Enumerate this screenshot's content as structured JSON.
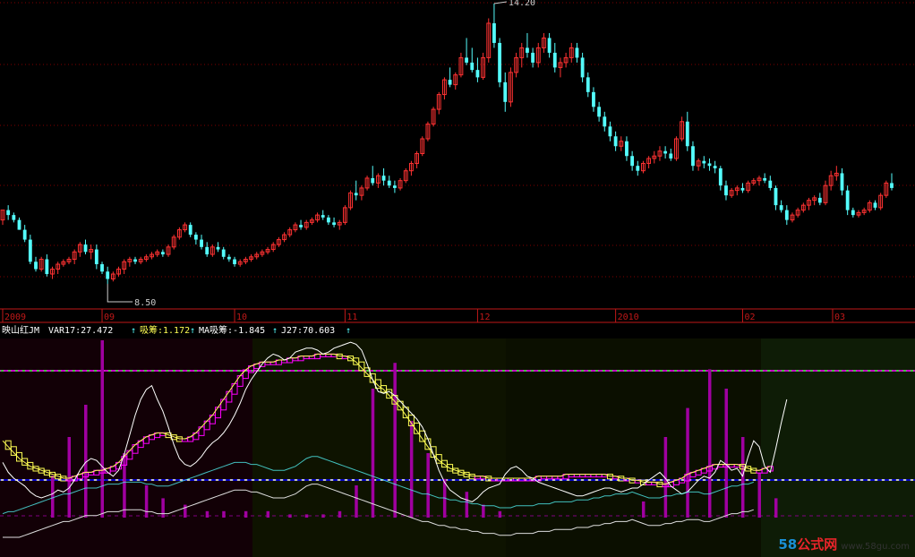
{
  "colors": {
    "up": "#ff3232",
    "down": "#54fcfc",
    "grid": "#800000",
    "axis": "#c01818",
    "var17": "#ffffff",
    "xichou": "#ff00ff",
    "ma_xichou": "#ffff54",
    "j27": "#54fcfc",
    "bars": "#a000a0",
    "line_top": "#54ff54",
    "line_mid_white": "#ffffff",
    "line_mid_blue": "#0000ff",
    "line_low": "#800080"
  },
  "chart_data": {
    "type": "candlestick",
    "price_labels": {
      "high": "14.20",
      "low": "8.50"
    },
    "x_ticks": [
      "2009",
      "09",
      "10",
      "11",
      "12",
      "2010",
      "02",
      "03"
    ],
    "indicator": {
      "name": "映山红JM",
      "items": [
        {
          "label": "VAR17",
          "value": "27.472",
          "color": "#ffffff"
        },
        {
          "label": "吸筹",
          "value": "1.172",
          "color": "#ffff54"
        },
        {
          "label": "MA吸筹",
          "value": "-1.845",
          "color": "#ffffff"
        },
        {
          "label": "J27",
          "value": "70.603",
          "color": "#ffffff"
        }
      ]
    },
    "candles": [
      [
        9.8,
        10.0,
        9.7,
        10.0
      ],
      [
        10.0,
        10.1,
        9.8,
        9.9
      ],
      [
        9.9,
        9.95,
        9.75,
        9.8
      ],
      [
        9.8,
        9.85,
        9.6,
        9.6
      ],
      [
        9.6,
        9.7,
        9.35,
        9.4
      ],
      [
        9.4,
        9.5,
        8.9,
        8.95
      ],
      [
        8.95,
        9.05,
        8.75,
        8.8
      ],
      [
        8.8,
        9.05,
        8.75,
        9.0
      ],
      [
        9.0,
        9.1,
        8.65,
        8.7
      ],
      [
        8.7,
        8.85,
        8.6,
        8.8
      ],
      [
        8.8,
        8.95,
        8.7,
        8.9
      ],
      [
        8.9,
        9.0,
        8.85,
        8.95
      ],
      [
        8.95,
        9.05,
        8.9,
        9.0
      ],
      [
        9.0,
        9.2,
        8.9,
        9.15
      ],
      [
        9.15,
        9.35,
        9.05,
        9.3
      ],
      [
        9.3,
        9.4,
        9.1,
        9.15
      ],
      [
        9.15,
        9.3,
        9.0,
        9.2
      ],
      [
        9.2,
        9.3,
        8.8,
        8.9
      ],
      [
        8.9,
        8.95,
        8.7,
        8.75
      ],
      [
        8.75,
        8.85,
        8.5,
        8.6
      ],
      [
        8.6,
        8.75,
        8.55,
        8.7
      ],
      [
        8.7,
        8.85,
        8.65,
        8.8
      ],
      [
        8.8,
        9.0,
        8.7,
        8.95
      ],
      [
        8.95,
        9.05,
        8.85,
        9.0
      ],
      [
        9.0,
        9.05,
        8.9,
        8.95
      ],
      [
        8.95,
        9.05,
        8.9,
        9.0
      ],
      [
        9.0,
        9.1,
        8.95,
        9.05
      ],
      [
        9.05,
        9.15,
        9.0,
        9.1
      ],
      [
        9.1,
        9.2,
        9.05,
        9.15
      ],
      [
        9.15,
        9.2,
        9.05,
        9.1
      ],
      [
        9.1,
        9.3,
        9.05,
        9.25
      ],
      [
        9.25,
        9.5,
        9.2,
        9.45
      ],
      [
        9.45,
        9.65,
        9.4,
        9.6
      ],
      [
        9.6,
        9.75,
        9.55,
        9.7
      ],
      [
        9.7,
        9.75,
        9.45,
        9.5
      ],
      [
        9.5,
        9.55,
        9.3,
        9.4
      ],
      [
        9.4,
        9.5,
        9.2,
        9.25
      ],
      [
        9.25,
        9.35,
        9.05,
        9.1
      ],
      [
        9.1,
        9.3,
        9.05,
        9.25
      ],
      [
        9.25,
        9.35,
        9.15,
        9.2
      ],
      [
        9.2,
        9.25,
        9.0,
        9.05
      ],
      [
        9.05,
        9.1,
        8.95,
        9.0
      ],
      [
        9.0,
        9.05,
        8.85,
        8.9
      ],
      [
        8.9,
        9.0,
        8.85,
        8.95
      ],
      [
        8.95,
        9.05,
        8.9,
        9.0
      ],
      [
        9.0,
        9.1,
        8.95,
        9.05
      ],
      [
        9.05,
        9.15,
        9.0,
        9.1
      ],
      [
        9.1,
        9.2,
        9.05,
        9.15
      ],
      [
        9.15,
        9.25,
        9.1,
        9.2
      ],
      [
        9.2,
        9.35,
        9.15,
        9.3
      ],
      [
        9.3,
        9.45,
        9.25,
        9.4
      ],
      [
        9.4,
        9.55,
        9.35,
        9.5
      ],
      [
        9.5,
        9.65,
        9.45,
        9.6
      ],
      [
        9.6,
        9.75,
        9.55,
        9.7
      ],
      [
        9.7,
        9.8,
        9.6,
        9.65
      ],
      [
        9.65,
        9.8,
        9.6,
        9.75
      ],
      [
        9.75,
        9.85,
        9.7,
        9.8
      ],
      [
        9.8,
        9.95,
        9.75,
        9.9
      ],
      [
        9.9,
        10.0,
        9.8,
        9.85
      ],
      [
        9.85,
        9.9,
        9.7,
        9.75
      ],
      [
        9.75,
        9.85,
        9.65,
        9.7
      ],
      [
        9.7,
        9.8,
        9.6,
        9.75
      ],
      [
        9.75,
        10.1,
        9.7,
        10.05
      ],
      [
        10.05,
        10.4,
        10.0,
        10.35
      ],
      [
        10.35,
        10.6,
        10.2,
        10.3
      ],
      [
        10.3,
        10.5,
        10.2,
        10.45
      ],
      [
        10.45,
        10.7,
        10.4,
        10.65
      ],
      [
        10.65,
        10.9,
        10.5,
        10.55
      ],
      [
        10.55,
        10.75,
        10.45,
        10.7
      ],
      [
        10.7,
        10.85,
        10.5,
        10.6
      ],
      [
        10.6,
        10.7,
        10.45,
        10.5
      ],
      [
        10.5,
        10.6,
        10.35,
        10.45
      ],
      [
        10.45,
        10.65,
        10.4,
        10.6
      ],
      [
        10.6,
        10.85,
        10.55,
        10.8
      ],
      [
        10.8,
        11.0,
        10.7,
        10.95
      ],
      [
        10.95,
        11.2,
        10.85,
        11.15
      ],
      [
        11.15,
        11.5,
        11.1,
        11.45
      ],
      [
        11.45,
        11.8,
        11.4,
        11.75
      ],
      [
        11.75,
        12.1,
        11.7,
        12.05
      ],
      [
        12.05,
        12.4,
        11.95,
        12.35
      ],
      [
        12.35,
        12.7,
        12.25,
        12.65
      ],
      [
        12.65,
        12.9,
        12.5,
        12.55
      ],
      [
        12.55,
        12.8,
        12.45,
        12.75
      ],
      [
        12.75,
        13.2,
        12.7,
        13.1
      ],
      [
        13.1,
        13.5,
        12.95,
        13.0
      ],
      [
        13.0,
        13.3,
        12.8,
        12.85
      ],
      [
        12.85,
        13.1,
        12.6,
        12.7
      ],
      [
        12.7,
        13.2,
        12.65,
        13.1
      ],
      [
        13.1,
        13.9,
        13.0,
        13.8
      ],
      [
        13.8,
        14.2,
        13.3,
        13.4
      ],
      [
        13.4,
        13.5,
        12.5,
        12.6
      ],
      [
        12.6,
        12.8,
        12.0,
        12.2
      ],
      [
        12.2,
        12.9,
        12.1,
        12.8
      ],
      [
        12.8,
        13.2,
        12.7,
        13.1
      ],
      [
        13.1,
        13.4,
        12.9,
        13.3
      ],
      [
        13.3,
        13.6,
        13.1,
        13.2
      ],
      [
        13.2,
        13.3,
        12.9,
        13.0
      ],
      [
        13.0,
        13.4,
        12.9,
        13.3
      ],
      [
        13.3,
        13.6,
        13.2,
        13.5
      ],
      [
        13.5,
        13.6,
        13.1,
        13.2
      ],
      [
        13.2,
        13.4,
        12.8,
        12.9
      ],
      [
        12.9,
        13.1,
        12.7,
        13.0
      ],
      [
        13.0,
        13.2,
        12.9,
        13.1
      ],
      [
        13.1,
        13.4,
        13.0,
        13.3
      ],
      [
        13.3,
        13.4,
        13.0,
        13.1
      ],
      [
        13.1,
        13.2,
        12.6,
        12.7
      ],
      [
        12.7,
        12.8,
        12.3,
        12.4
      ],
      [
        12.4,
        12.5,
        12.0,
        12.1
      ],
      [
        12.1,
        12.2,
        11.8,
        11.9
      ],
      [
        11.9,
        12.0,
        11.6,
        11.7
      ],
      [
        11.7,
        11.8,
        11.4,
        11.5
      ],
      [
        11.5,
        11.6,
        11.2,
        11.3
      ],
      [
        11.3,
        11.5,
        11.2,
        11.4
      ],
      [
        11.4,
        11.5,
        11.0,
        11.1
      ],
      [
        11.1,
        11.2,
        10.8,
        10.9
      ],
      [
        10.9,
        11.0,
        10.7,
        10.8
      ],
      [
        10.8,
        11.0,
        10.75,
        10.95
      ],
      [
        10.95,
        11.1,
        10.85,
        11.05
      ],
      [
        11.05,
        11.2,
        10.95,
        11.1
      ],
      [
        11.1,
        11.3,
        11.0,
        11.2
      ],
      [
        11.2,
        11.3,
        11.05,
        11.15
      ],
      [
        11.15,
        11.25,
        11.0,
        11.05
      ],
      [
        11.05,
        11.5,
        11.0,
        11.45
      ],
      [
        11.45,
        11.9,
        11.4,
        11.8
      ],
      [
        11.8,
        12.0,
        11.2,
        11.3
      ],
      [
        11.3,
        11.4,
        10.8,
        10.9
      ],
      [
        10.9,
        11.05,
        10.8,
        11.0
      ],
      [
        11.0,
        11.1,
        10.85,
        10.95
      ],
      [
        10.95,
        11.05,
        10.8,
        10.9
      ],
      [
        10.9,
        11.0,
        10.75,
        10.85
      ],
      [
        10.85,
        10.9,
        10.4,
        10.5
      ],
      [
        10.5,
        10.6,
        10.2,
        10.3
      ],
      [
        10.3,
        10.45,
        10.25,
        10.4
      ],
      [
        10.4,
        10.5,
        10.3,
        10.45
      ],
      [
        10.45,
        10.55,
        10.35,
        10.4
      ],
      [
        10.4,
        10.6,
        10.35,
        10.55
      ],
      [
        10.55,
        10.65,
        10.5,
        10.6
      ],
      [
        10.6,
        10.7,
        10.5,
        10.65
      ],
      [
        10.65,
        10.75,
        10.55,
        10.6
      ],
      [
        10.6,
        10.7,
        10.4,
        10.45
      ],
      [
        10.45,
        10.5,
        10.0,
        10.1
      ],
      [
        10.1,
        10.2,
        9.95,
        10.0
      ],
      [
        10.0,
        10.1,
        9.7,
        9.8
      ],
      [
        9.8,
        9.95,
        9.75,
        9.9
      ],
      [
        9.9,
        10.05,
        9.85,
        10.0
      ],
      [
        10.0,
        10.15,
        9.95,
        10.1
      ],
      [
        10.1,
        10.25,
        10.0,
        10.2
      ],
      [
        10.2,
        10.3,
        10.1,
        10.25
      ],
      [
        10.25,
        10.35,
        10.1,
        10.15
      ],
      [
        10.15,
        10.6,
        10.1,
        10.5
      ],
      [
        10.5,
        10.8,
        10.4,
        10.7
      ],
      [
        10.7,
        10.9,
        10.6,
        10.75
      ],
      [
        10.75,
        10.85,
        10.3,
        10.4
      ],
      [
        10.4,
        10.5,
        9.9,
        10.0
      ],
      [
        10.0,
        10.05,
        9.85,
        9.9
      ],
      [
        9.9,
        10.0,
        9.85,
        9.95
      ],
      [
        9.95,
        10.05,
        9.9,
        10.0
      ],
      [
        10.0,
        10.2,
        9.95,
        10.15
      ],
      [
        10.15,
        10.2,
        10.0,
        10.05
      ],
      [
        10.05,
        10.35,
        10.0,
        10.3
      ],
      [
        10.3,
        10.6,
        10.25,
        10.55
      ],
      [
        10.55,
        10.75,
        10.4,
        10.45
      ]
    ],
    "var17": [
      38,
      33,
      30,
      28,
      26,
      23,
      21,
      20,
      21,
      22,
      24,
      23,
      25,
      29,
      34,
      38,
      40,
      39,
      36,
      33,
      31,
      34,
      42,
      52,
      62,
      70,
      75,
      77,
      70,
      64,
      56,
      47,
      40,
      37,
      36,
      38,
      41,
      45,
      48,
      50,
      53,
      57,
      62,
      68,
      75,
      80,
      84,
      88,
      91,
      93,
      92,
      90,
      91,
      94,
      95,
      96,
      96,
      95,
      93,
      94,
      96,
      97,
      98,
      99,
      98,
      95,
      88,
      80,
      74,
      73,
      74,
      72,
      69,
      66,
      63,
      60,
      56,
      50,
      42,
      34,
      28,
      24,
      22,
      20,
      19,
      18,
      20,
      23,
      25,
      26,
      27,
      32,
      35,
      36,
      34,
      31,
      30,
      28,
      27,
      26,
      25,
      24,
      23,
      22,
      21,
      21,
      22,
      23,
      24,
      25,
      25,
      24,
      23,
      24,
      25,
      25,
      27,
      29,
      31,
      33,
      30,
      26,
      24,
      22,
      23,
      26,
      29,
      31,
      30,
      33,
      39,
      37,
      34,
      35,
      31,
      41,
      49,
      46,
      36,
      33,
      45,
      58,
      70
    ],
    "xichou": [
      49,
      46,
      43,
      40,
      38,
      36,
      35,
      34,
      33,
      32,
      31,
      30,
      30,
      31,
      32,
      33,
      33,
      34,
      34,
      35,
      36,
      38,
      41,
      44,
      47,
      49,
      51,
      52,
      53,
      53,
      52,
      51,
      50,
      50,
      51,
      53,
      56,
      59,
      62,
      66,
      70,
      74,
      78,
      82,
      85,
      87,
      88,
      89,
      89,
      89,
      90,
      90,
      91,
      91,
      92,
      92,
      92,
      93,
      93,
      93,
      93,
      92,
      92,
      91,
      89,
      86,
      83,
      80,
      77,
      75,
      72,
      69,
      66,
      62,
      58,
      54,
      50,
      46,
      42,
      39,
      37,
      35,
      34,
      33,
      32,
      31,
      31,
      31,
      30,
      30,
      30,
      30,
      30,
      30,
      30,
      30,
      30,
      31,
      31,
      31,
      31,
      31,
      32,
      32,
      32,
      32,
      32,
      32,
      32,
      32,
      31,
      31,
      30,
      30,
      29,
      29,
      28,
      28,
      28,
      27,
      27,
      28,
      29,
      30,
      32,
      33,
      34,
      35,
      36,
      37,
      37,
      37,
      37,
      37,
      36,
      35,
      34,
      34,
      35,
      36
    ],
    "j27": [
      12,
      13,
      13,
      14,
      15,
      16,
      17,
      18,
      19,
      20,
      21,
      22,
      22,
      23,
      24,
      25,
      25,
      25,
      26,
      27,
      27,
      27,
      28,
      28,
      28,
      28,
      27,
      27,
      26,
      26,
      26,
      27,
      28,
      29,
      30,
      31,
      32,
      33,
      34,
      35,
      36,
      37,
      38,
      38,
      38,
      37,
      37,
      36,
      35,
      34,
      34,
      34,
      35,
      36,
      38,
      40,
      41,
      41,
      40,
      39,
      38,
      37,
      36,
      35,
      34,
      33,
      32,
      31,
      30,
      29,
      28,
      27,
      26,
      25,
      24,
      23,
      22,
      22,
      21,
      20,
      20,
      19,
      19,
      18,
      18,
      17,
      17,
      16,
      16,
      16,
      15,
      15,
      15,
      16,
      16,
      16,
      16,
      17,
      17,
      17,
      18,
      18,
      18,
      18,
      19,
      19,
      19,
      20,
      20,
      21,
      21,
      22,
      22,
      22,
      23,
      22,
      21,
      20,
      20,
      20,
      21,
      21,
      22,
      22,
      23,
      23,
      23,
      22,
      22,
      23,
      24,
      25,
      26,
      26,
      27,
      27,
      28
    ],
    "bars": [
      [
        9,
        13
      ],
      [
        12,
        25
      ],
      [
        15,
        35
      ],
      [
        18,
        55
      ],
      [
        22,
        20
      ],
      [
        26,
        10
      ],
      [
        29,
        6
      ],
      [
        33,
        4
      ],
      [
        37,
        2
      ],
      [
        40,
        2
      ],
      [
        44,
        2
      ],
      [
        48,
        2
      ],
      [
        52,
        1
      ],
      [
        55,
        1
      ],
      [
        58,
        1
      ],
      [
        61,
        2
      ],
      [
        64,
        10
      ],
      [
        67,
        40
      ],
      [
        71,
        48
      ],
      [
        74,
        30
      ],
      [
        77,
        20
      ],
      [
        80,
        12
      ],
      [
        84,
        8
      ],
      [
        87,
        4
      ],
      [
        90,
        2
      ],
      [
        116,
        5
      ],
      [
        120,
        25
      ],
      [
        124,
        34
      ],
      [
        128,
        46
      ],
      [
        131,
        40
      ],
      [
        134,
        25
      ],
      [
        137,
        14
      ],
      [
        140,
        6
      ]
    ]
  }
}
